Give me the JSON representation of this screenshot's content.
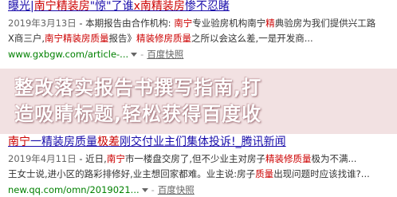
{
  "results": [
    {
      "title_pre": "曝光",
      "title_sep": "|",
      "title_em1": "南宁精装房",
      "title_mid": "\"惊\"了谁",
      "title_em2": "x南精装房",
      "title_post": "惨不忍睹",
      "line1_date": "2019年3月13日",
      "line1_text": " - 本期报告由合作机构: ",
      "line1_em": "南宁",
      "line1_text2": "专业验房机构南宁",
      "line1_em2": "精",
      "line1_text3": "典验房为我们提供兴工路",
      "line2_text": "X商三户,",
      "line2_em": "南宁精装房",
      "line2_em2": "质量",
      "line2_text2": "报告》",
      "line2_em3": "精装修房质量",
      "line2_text3": "之所以会这么差,一是开发商...",
      "url": "www.gxbgw.com/article-...",
      "snapshot": "百度快照"
    },
    {
      "title_em1": "南宁",
      "title_mid": "一精装房质量",
      "title_em2": "极差",
      "title_post": "刚交付业主们集体投诉!_腾讯新闻",
      "line1_date": "2019年4月11日",
      "line1_text": " - 近日,",
      "line1_em": "南宁",
      "line1_text2": "市一楼盘交房了,但不少业主对房子",
      "line1_em2": "精装修质量",
      "line1_text3": "极为不满...",
      "line2_text": "王女士说,进小区的路彩排修好,业主想回家都难。业主说:房子",
      "line2_em": "质量",
      "line2_text2": "出现问题时应该找谁?...",
      "url": "new.qq.com/omn/2019021...",
      "snapshot": "百度快照"
    }
  ],
  "banner": {
    "line1": "整改落实报告书撰写指南,打",
    "line2": "造吸睛标题,轻松获得百度收"
  },
  "colors": {
    "title": "#1a0dab",
    "highlight": "#cc0000",
    "url": "#008000",
    "banner_bg": "#f1dee0"
  }
}
